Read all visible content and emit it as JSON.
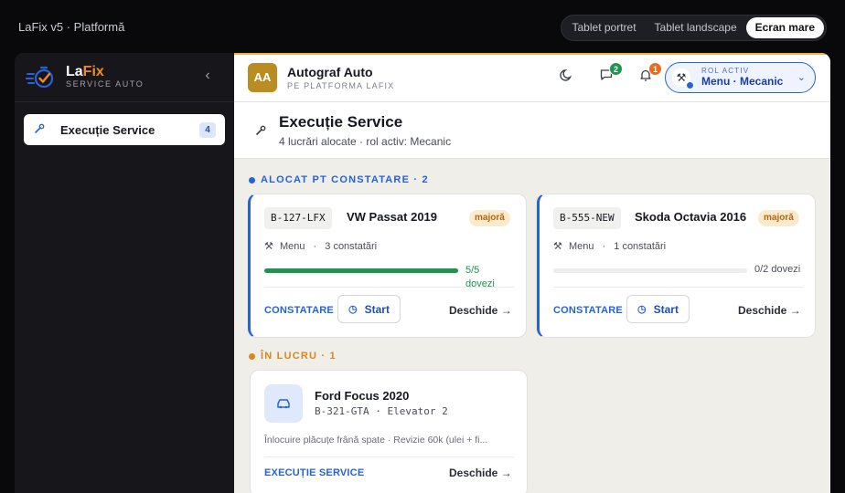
{
  "window": {
    "title": "LaFix v5 · Platformă"
  },
  "view_modes": {
    "options": [
      "Tablet portret",
      "Tablet landscape",
      "Ecran mare"
    ],
    "selected": "Ecran mare"
  },
  "brand": {
    "name_a": "La",
    "name_b": "Fix",
    "subtitle": "SERVICE AUTO"
  },
  "sidebar": {
    "items": [
      {
        "label": "Execuție Service",
        "count": "4"
      }
    ]
  },
  "header": {
    "org_initials": "AA",
    "org_name": "Autograf Auto",
    "org_sub": "PE PLATFORMA LAFIX",
    "messages_badge": "2",
    "notifications_badge": "1",
    "role_caption": "ROL ACTIV",
    "role_value": "Menu · Mecanic"
  },
  "page": {
    "title": "Execuție Service",
    "subtitle": "4 lucrări alocate · rol activ: Mecanic"
  },
  "sections": {
    "alocat": {
      "label": "ALOCAT PT CONSTATARE · 2",
      "color": "#2563d9"
    },
    "in_lucru": {
      "label": "ÎN LUCRU · 1",
      "color": "#d9871e"
    }
  },
  "alocat_cards": [
    {
      "plate": "B-127-LFX",
      "model": "VW Passat 2019",
      "tag": "majoră",
      "assignee": "Menu",
      "findings": "3 constatări",
      "parts_text": "5/5 dovezi",
      "parts_fraction": 1.0,
      "action_label": "CONSTATARE",
      "start_label": "Start",
      "open_label": "Deschide →"
    },
    {
      "plate": "B-555-NEW",
      "model": "Skoda Octavia 2016",
      "tag": "majoră",
      "assignee": "Menu",
      "findings": "1 constatări",
      "parts_text": "0/2 dovezi",
      "parts_fraction": 0.0,
      "action_label": "CONSTATARE",
      "start_label": "Start",
      "open_label": "Deschide →"
    }
  ],
  "in_lucru_cards": [
    {
      "model": "Ford Focus 2020",
      "plate_location": "B-321-GTA · Elevator 2",
      "description": "Înlocuire plăcuțe frână spate · Revizie 60k (ulei + fi...",
      "action_label": "EXECUȚIE SERVICE",
      "open_label": "Deschide →"
    }
  ]
}
